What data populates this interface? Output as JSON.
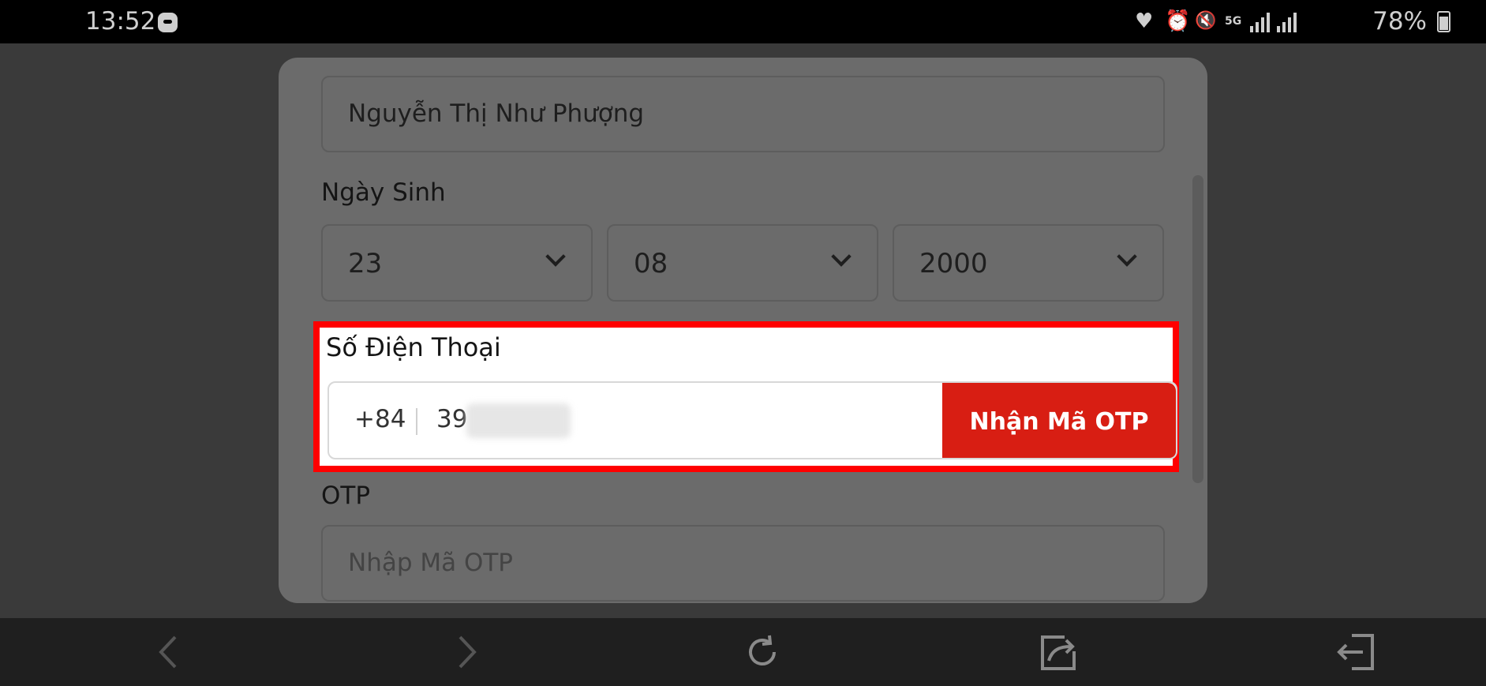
{
  "status_bar": {
    "time": "13:52",
    "battery_text": "78%",
    "icons": [
      "game-icon",
      "heart-icon",
      "alarm-icon",
      "mute-icon",
      "5g-icon",
      "signal-icon",
      "signal-icon",
      "battery-icon"
    ]
  },
  "form": {
    "name_value": "Nguyễn Thị Như Phượng",
    "dob": {
      "label": "Ngày Sinh",
      "day": "23",
      "month": "08",
      "year": "2000"
    },
    "phone": {
      "label": "Số Điện Thoại",
      "country_code": "+84",
      "value_visible": "39",
      "otp_button_label": "Nhận Mã OTP"
    },
    "otp": {
      "label": "OTP",
      "placeholder": "Nhập Mã OTP"
    }
  },
  "nav_bar": {
    "icons": [
      "back-icon",
      "forward-icon",
      "reload-icon",
      "share-icon",
      "exit-icon"
    ]
  },
  "colors": {
    "accent_red": "#d81e13",
    "highlight_border": "#ff0000"
  }
}
